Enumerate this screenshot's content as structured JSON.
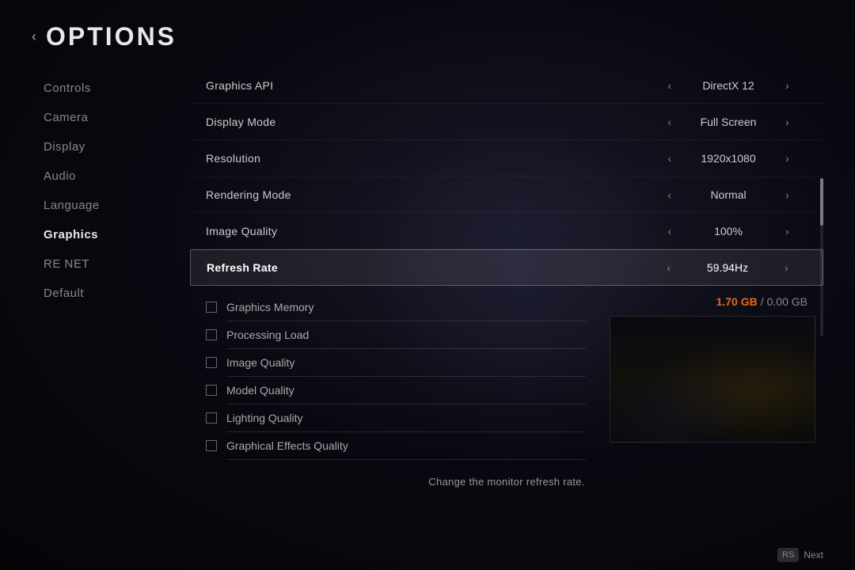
{
  "header": {
    "back_arrow": "‹",
    "title": "OPTIONS"
  },
  "sidebar": {
    "items": [
      {
        "id": "controls",
        "label": "Controls",
        "active": false
      },
      {
        "id": "camera",
        "label": "Camera",
        "active": false
      },
      {
        "id": "display",
        "label": "Display",
        "active": false
      },
      {
        "id": "audio",
        "label": "Audio",
        "active": false
      },
      {
        "id": "language",
        "label": "Language",
        "active": false
      },
      {
        "id": "graphics",
        "label": "Graphics",
        "active": true
      },
      {
        "id": "re-net",
        "label": "RE NET",
        "active": false
      },
      {
        "id": "default",
        "label": "Default",
        "active": false
      }
    ]
  },
  "settings": {
    "rows": [
      {
        "id": "graphics-api",
        "label": "Graphics API",
        "value": "DirectX 12",
        "highlighted": false
      },
      {
        "id": "display-mode",
        "label": "Display Mode",
        "value": "Full Screen",
        "highlighted": false
      },
      {
        "id": "resolution",
        "label": "Resolution",
        "value": "1920x1080",
        "highlighted": false
      },
      {
        "id": "rendering-mode",
        "label": "Rendering Mode",
        "value": "Normal",
        "highlighted": false
      },
      {
        "id": "image-quality",
        "label": "Image Quality",
        "value": "100%",
        "highlighted": false
      },
      {
        "id": "refresh-rate",
        "label": "Refresh Rate",
        "value": "59.94Hz",
        "highlighted": true
      }
    ]
  },
  "checkboxes": {
    "memory_used": "1.70 GB",
    "memory_sep": "/",
    "memory_total": "0.00 GB",
    "items": [
      {
        "id": "graphics-memory",
        "label": "Graphics Memory",
        "checked": false
      },
      {
        "id": "processing-load",
        "label": "Processing Load",
        "checked": false
      },
      {
        "id": "image-quality-cb",
        "label": "Image Quality",
        "checked": false
      },
      {
        "id": "model-quality",
        "label": "Model Quality",
        "checked": false
      },
      {
        "id": "lighting-quality",
        "label": "Lighting Quality",
        "checked": false
      },
      {
        "id": "graphical-effects-quality",
        "label": "Graphical Effects Quality",
        "checked": false
      }
    ]
  },
  "status_bar": {
    "message": "Change the monitor refresh rate."
  },
  "nav_footer": {
    "button_label": "Next"
  },
  "icons": {
    "chevron_left": "‹",
    "chevron_right": "›"
  }
}
